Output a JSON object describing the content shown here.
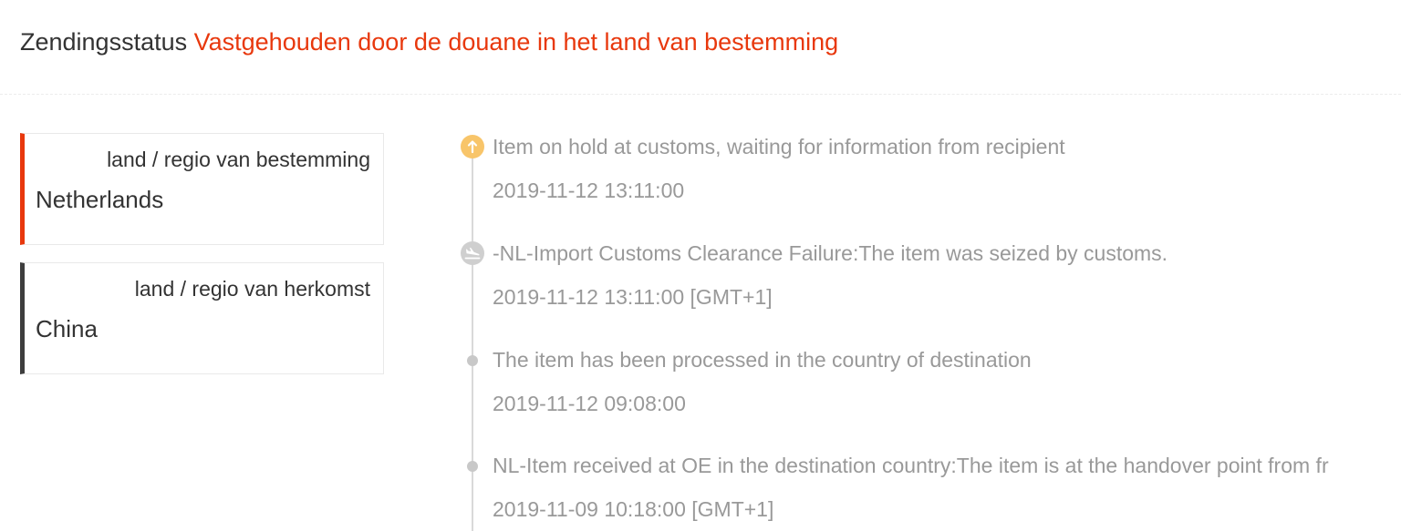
{
  "header": {
    "status_label": "Zendingsstatus",
    "status_value": "Vastgehouden door de douane in het land van bestemming"
  },
  "destination": {
    "label": "land / regio van bestemming",
    "value": "Netherlands"
  },
  "origin": {
    "label": "land / regio van herkomst",
    "value": "China"
  },
  "colors": {
    "status_accent": "#e8380d",
    "origin_accent": "#3d3d3d",
    "alert_icon": "#f8c56a",
    "muted_text": "#999999"
  },
  "events": [
    {
      "icon": "alert-arrow-up-icon",
      "description": "Item on hold at customs, waiting for information from recipient",
      "time": "2019-11-12 13:11:00"
    },
    {
      "icon": "plane-landing-icon",
      "description": "-NL-Import Customs Clearance Failure:The item was seized by customs.",
      "time": "2019-11-12 13:11:00 [GMT+1]"
    },
    {
      "icon": "dot-icon",
      "description": "The item has been processed in the country of destination",
      "time": "2019-11-12 09:08:00"
    },
    {
      "icon": "dot-icon",
      "description": "NL-Item received at OE in the destination country:The item is at the handover point from fr",
      "time": "2019-11-09 10:18:00 [GMT+1]"
    }
  ]
}
